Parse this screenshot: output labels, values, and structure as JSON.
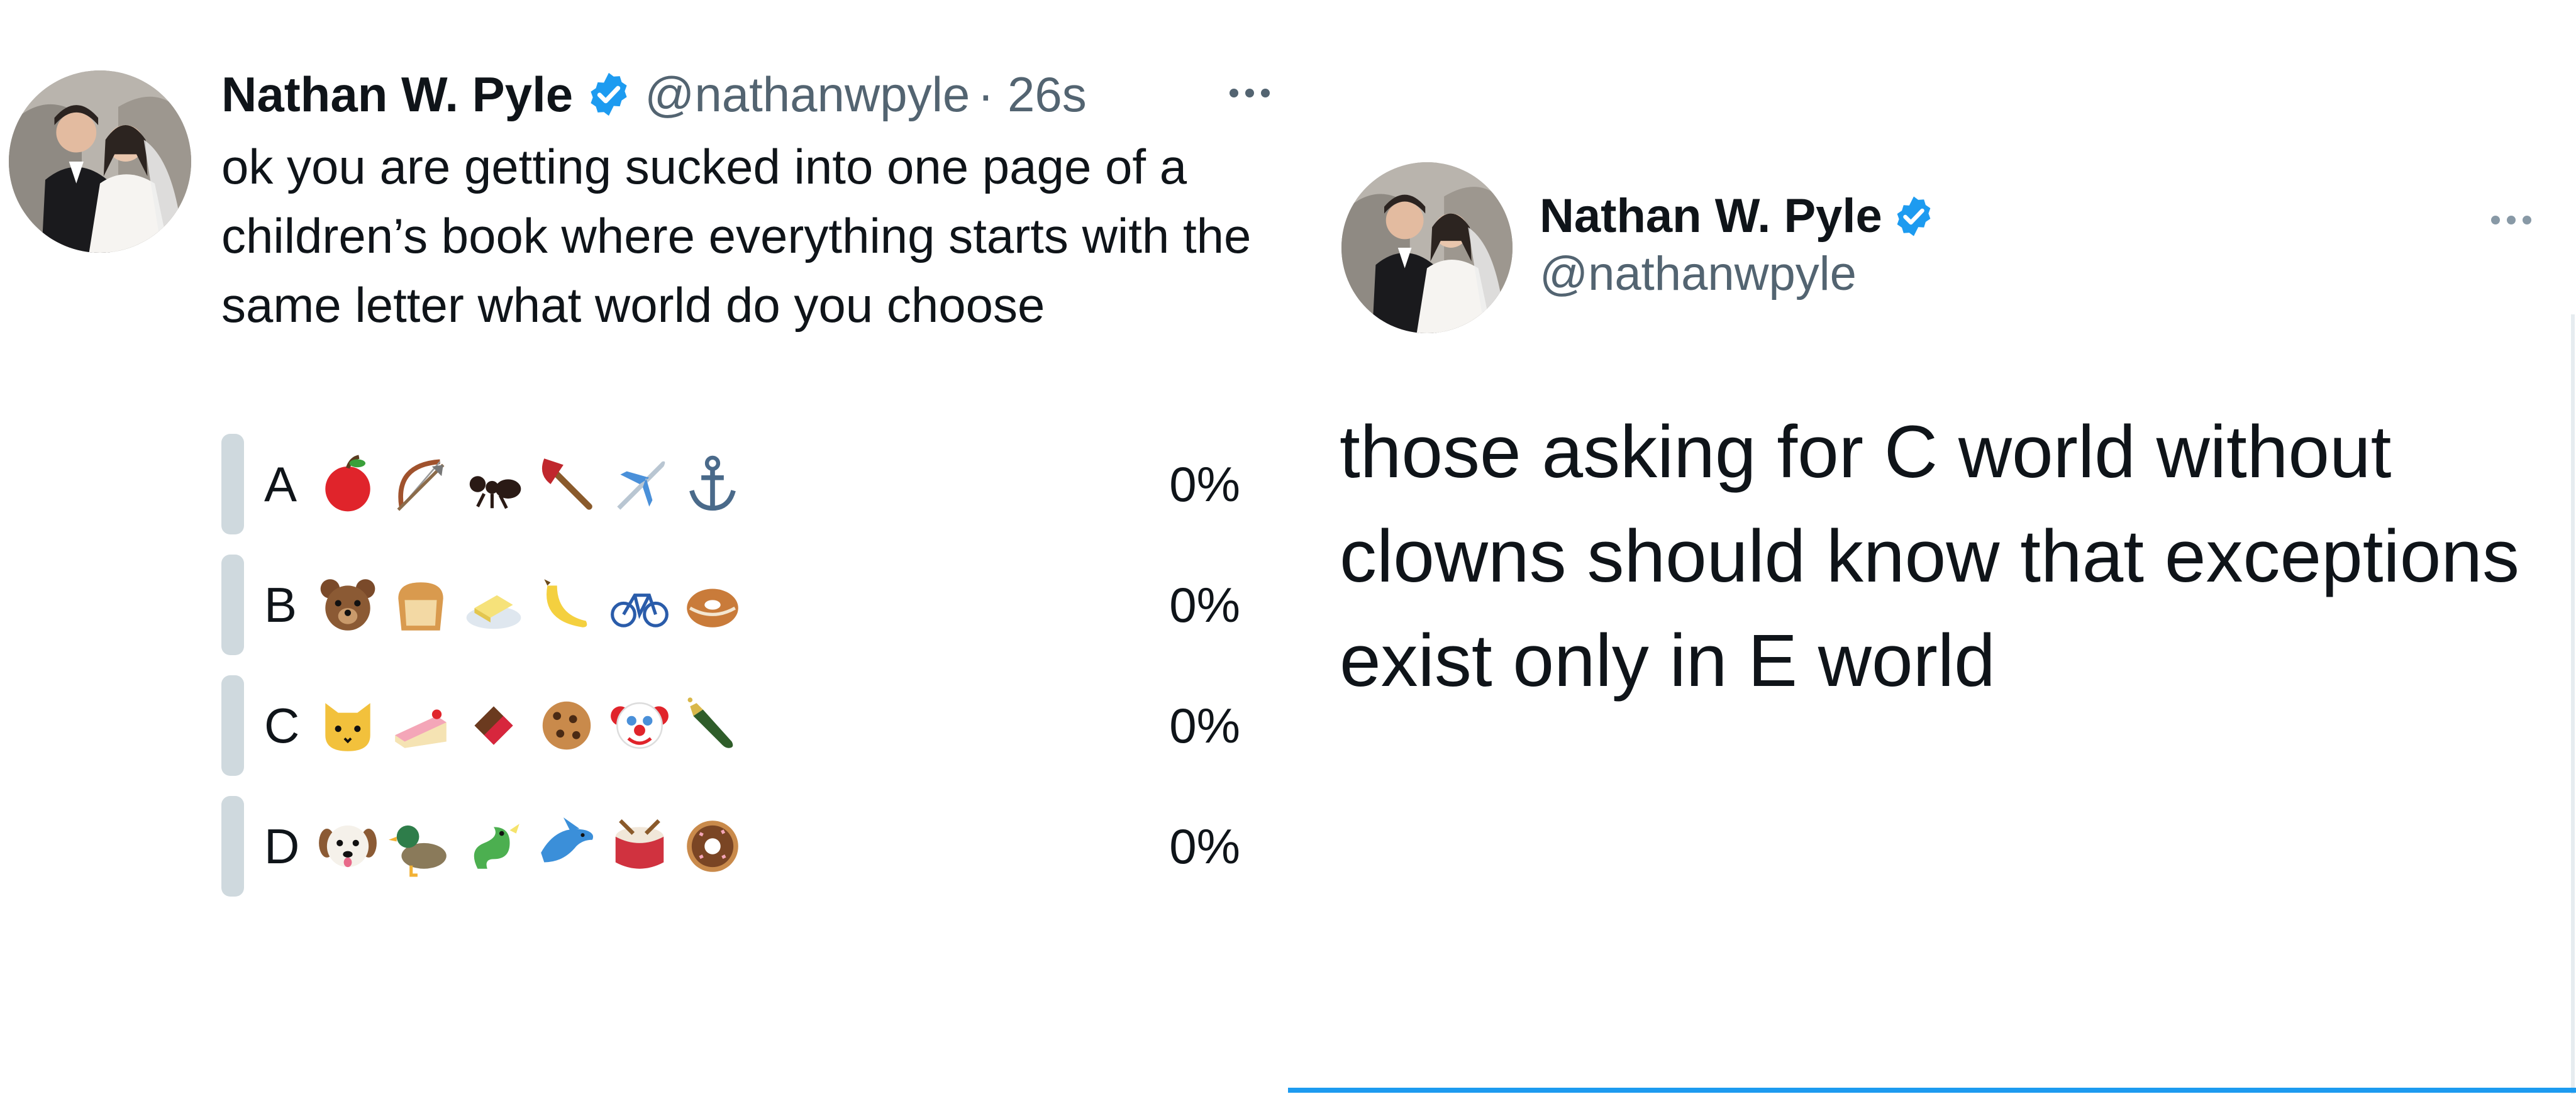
{
  "colors": {
    "verified_badge": "#1d9bf0",
    "handle_gray": "#536471",
    "poll_bar": "#cfd9de",
    "accent_line": "#1d9bf0"
  },
  "left_tweet": {
    "author_name": "Nathan W. Pyle",
    "author_handle": "@nathanwpyle",
    "timestamp": "· 26s",
    "body": "ok you are getting sucked into one page of a children’s book where everything starts with the same letter what world do you choose",
    "poll": [
      {
        "letter": "A",
        "percent": "0%",
        "icons": [
          "apple-icon",
          "bow-and-arrow-icon",
          "ant-icon",
          "axe-icon",
          "airplane-icon",
          "anchor-icon"
        ]
      },
      {
        "letter": "B",
        "percent": "0%",
        "icons": [
          "bear-icon",
          "bread-icon",
          "butter-icon",
          "banana-icon",
          "bicycle-icon",
          "bagel-icon"
        ]
      },
      {
        "letter": "C",
        "percent": "0%",
        "icons": [
          "cat-icon",
          "cake-icon",
          "chocolate-icon",
          "cookie-icon",
          "clown-icon",
          "champagne-icon"
        ]
      },
      {
        "letter": "D",
        "percent": "0%",
        "icons": [
          "dog-icon",
          "duck-icon",
          "dragon-icon",
          "dolphin-icon",
          "drum-icon",
          "donut-icon"
        ]
      }
    ]
  },
  "right_tweet": {
    "author_name": "Nathan W. Pyle",
    "author_handle": "@nathanwpyle",
    "body": "those asking for C world without clowns should know that exceptions exist only in E world"
  }
}
